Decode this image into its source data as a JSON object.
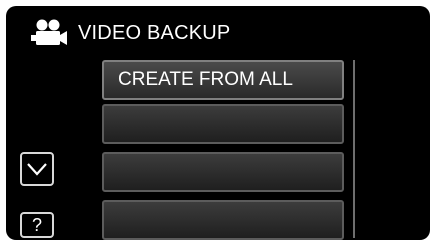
{
  "header": {
    "icon": "video-camera-icon",
    "title": "VIDEO BACKUP"
  },
  "menu": {
    "items": [
      {
        "label": "CREATE FROM ALL",
        "state": "selected"
      },
      {
        "label": "",
        "state": "disabled"
      },
      {
        "label": "",
        "state": "disabled"
      },
      {
        "label": "",
        "state": "disabled"
      }
    ]
  },
  "controls": {
    "scroll_down_icon": "chevron-down-icon",
    "help_label": "?"
  },
  "colors": {
    "background": "#000000",
    "text": "#ffffff",
    "disabled_text": "#5a5a5a",
    "border": "#6e6e6e"
  }
}
